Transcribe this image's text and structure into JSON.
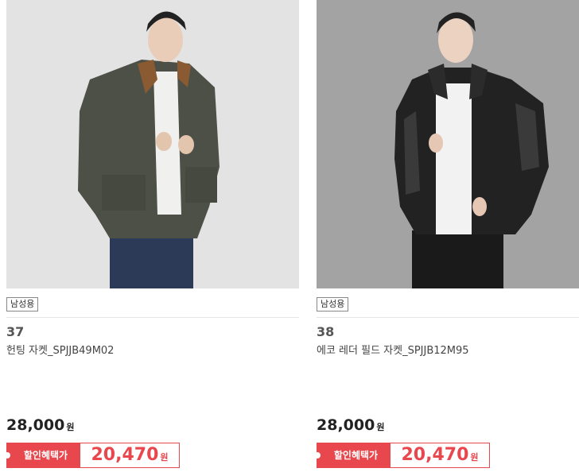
{
  "products": [
    {
      "badge": "남성용",
      "rank": "37",
      "name": "헌팅 자켓_SPJJB49M02",
      "price": "28,000",
      "currency": "원",
      "benefit_label": "할인혜택가",
      "benefit_price": "20,470",
      "photo_bg": "#e2e2e2",
      "jacket_color": "#4d5046"
    },
    {
      "badge": "남성용",
      "rank": "38",
      "name": "에코 레더 필드 자켓_SPJJB12M95",
      "price": "28,000",
      "currency": "원",
      "benefit_label": "할인혜택가",
      "benefit_price": "20,470",
      "photo_bg": "#9a9a9a",
      "jacket_color": "#1e1e1e"
    }
  ],
  "colors": {
    "accent": "#e8474d"
  }
}
